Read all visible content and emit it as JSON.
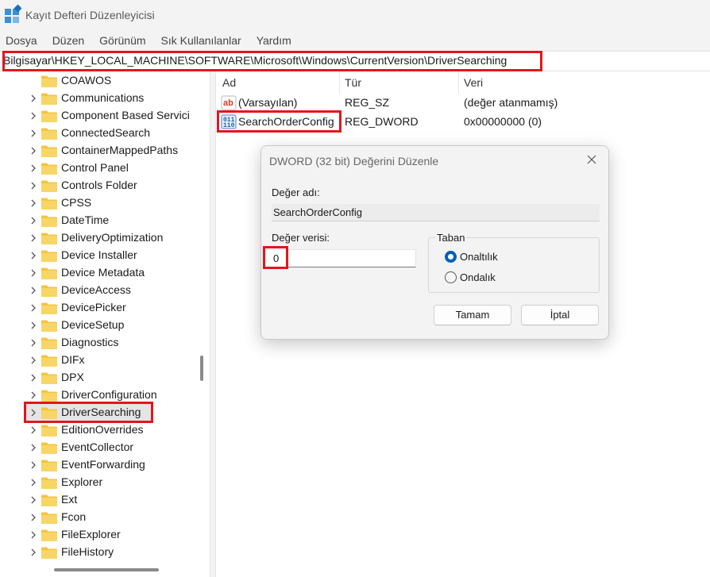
{
  "window": {
    "title": "Kayıt Defteri Düzenleyicisi"
  },
  "menu": [
    "Dosya",
    "Düzen",
    "Görünüm",
    "Sık Kullanılanlar",
    "Yardım"
  ],
  "address": {
    "path": "Bilgisayar\\HKEY_LOCAL_MACHINE\\SOFTWARE\\Microsoft\\Windows\\CurrentVersion\\DriverSearching"
  },
  "tree": {
    "selected": "DriverSearching",
    "items": [
      {
        "label": "COAWOS"
      },
      {
        "label": "Communications"
      },
      {
        "label": "Component Based Servici"
      },
      {
        "label": "ConnectedSearch"
      },
      {
        "label": "ContainerMappedPaths"
      },
      {
        "label": "Control Panel"
      },
      {
        "label": "Controls Folder"
      },
      {
        "label": "CPSS"
      },
      {
        "label": "DateTime"
      },
      {
        "label": "DeliveryOptimization"
      },
      {
        "label": "Device Installer"
      },
      {
        "label": "Device Metadata"
      },
      {
        "label": "DeviceAccess"
      },
      {
        "label": "DevicePicker"
      },
      {
        "label": "DeviceSetup"
      },
      {
        "label": "Diagnostics"
      },
      {
        "label": "DIFx"
      },
      {
        "label": "DPX"
      },
      {
        "label": "DriverConfiguration"
      },
      {
        "label": "DriverSearching"
      },
      {
        "label": "EditionOverrides"
      },
      {
        "label": "EventCollector"
      },
      {
        "label": "EventForwarding"
      },
      {
        "label": "Explorer"
      },
      {
        "label": "Ext"
      },
      {
        "label": "Fcon"
      },
      {
        "label": "FileExplorer"
      },
      {
        "label": "FileHistory"
      }
    ]
  },
  "list": {
    "columns": {
      "name": "Ad",
      "type": "Tür",
      "data": "Veri"
    },
    "rows": [
      {
        "icon": "string-value-icon",
        "name": "(Varsayılan)",
        "type": "REG_SZ",
        "data": "(değer atanmamış)"
      },
      {
        "icon": "binary-value-icon",
        "name": "SearchOrderConfig",
        "type": "REG_DWORD",
        "data": "0x00000000 (0)"
      }
    ]
  },
  "dialog": {
    "title": "DWORD (32 bit) Değerini Düzenle",
    "name_label": "Değer adı:",
    "name_value": "SearchOrderConfig",
    "data_label": "Değer verisi:",
    "data_value": "0",
    "base_title": "Taban",
    "base_options": [
      "Onaltılık",
      "Ondalık"
    ],
    "base_selected": "Onaltılık",
    "ok_label": "Tamam",
    "cancel_label": "İptal"
  },
  "colors": {
    "highlight": "#e2161c",
    "accent": "#005fb8",
    "folder": "#f4c542"
  }
}
